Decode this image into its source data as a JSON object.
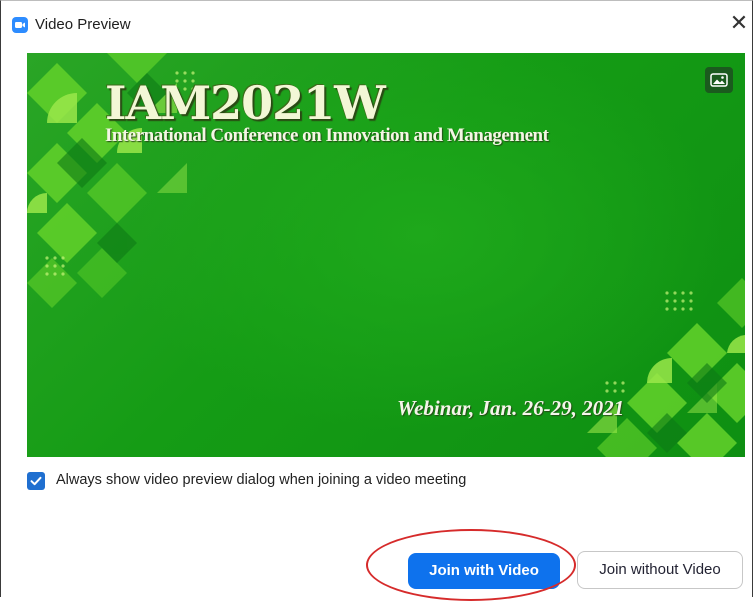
{
  "window": {
    "title": "Video Preview",
    "close_glyph": "✕",
    "app_icon": "zoom-camera-icon"
  },
  "preview": {
    "title": "IAM2021W",
    "subtitle": "International Conference on Innovation and Management",
    "date": "Webinar, Jan. 26-29, 2021",
    "background_icon": "image-icon",
    "colors": {
      "background": "#18a019",
      "accent_light": "#7fe03a",
      "accent_dark": "#0c7a12"
    }
  },
  "options": {
    "always_show_label": "Always show video preview dialog when joining a video meeting",
    "always_show_checked": true
  },
  "buttons": {
    "join_with_video": "Join with Video",
    "join_without_video": "Join without Video"
  },
  "colors": {
    "primary": "#0e72ed",
    "annotation_ring": "#d62b2b"
  }
}
